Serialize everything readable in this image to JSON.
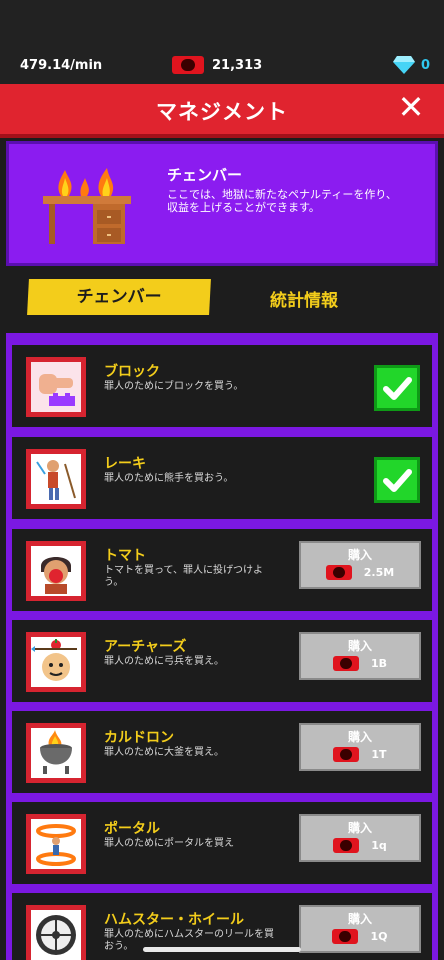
{
  "status": {
    "rate": "479.14/min",
    "money": "21,313",
    "gems": "0"
  },
  "header": {
    "title": "マネジメント",
    "close_label": "✕"
  },
  "intro": {
    "title": "チェンバー",
    "text": "ここでは、地獄に新たなペナルティーを作り、収益を上げることができます。"
  },
  "tabs": [
    {
      "label": "チェンバー"
    },
    {
      "label": "統計情報"
    }
  ],
  "items": [
    {
      "name": "ブロック",
      "desc": "罪人のためにブロックを買う。",
      "owned": true
    },
    {
      "name": "レーキ",
      "desc": "罪人のために熊手を買おう。",
      "owned": true
    },
    {
      "name": "トマト",
      "desc": "トマトを買って、罪人に投げつけよう。",
      "owned": false,
      "buy_label": "購入",
      "price": "2.5M"
    },
    {
      "name": "アーチャーズ",
      "desc": "罪人のために弓兵を買え。",
      "owned": false,
      "buy_label": "購入",
      "price": "1B"
    },
    {
      "name": "カルドロン",
      "desc": "罪人のために大釜を買え。",
      "owned": false,
      "buy_label": "購入",
      "price": "1T"
    },
    {
      "name": "ポータル",
      "desc": "罪人のためにポータルを買え",
      "owned": false,
      "buy_label": "購入",
      "price": "1q"
    },
    {
      "name": "ハムスター・ホイール",
      "desc": "罪人のためにハムスターのリールを買おう。",
      "owned": false,
      "buy_label": "購入",
      "price": "1Q"
    }
  ],
  "colors": {
    "header_red": "#e0242f",
    "panel_purple": "#8b1cf0",
    "tab_yellow": "#f3cd1b",
    "check_green": "#22d62a"
  }
}
